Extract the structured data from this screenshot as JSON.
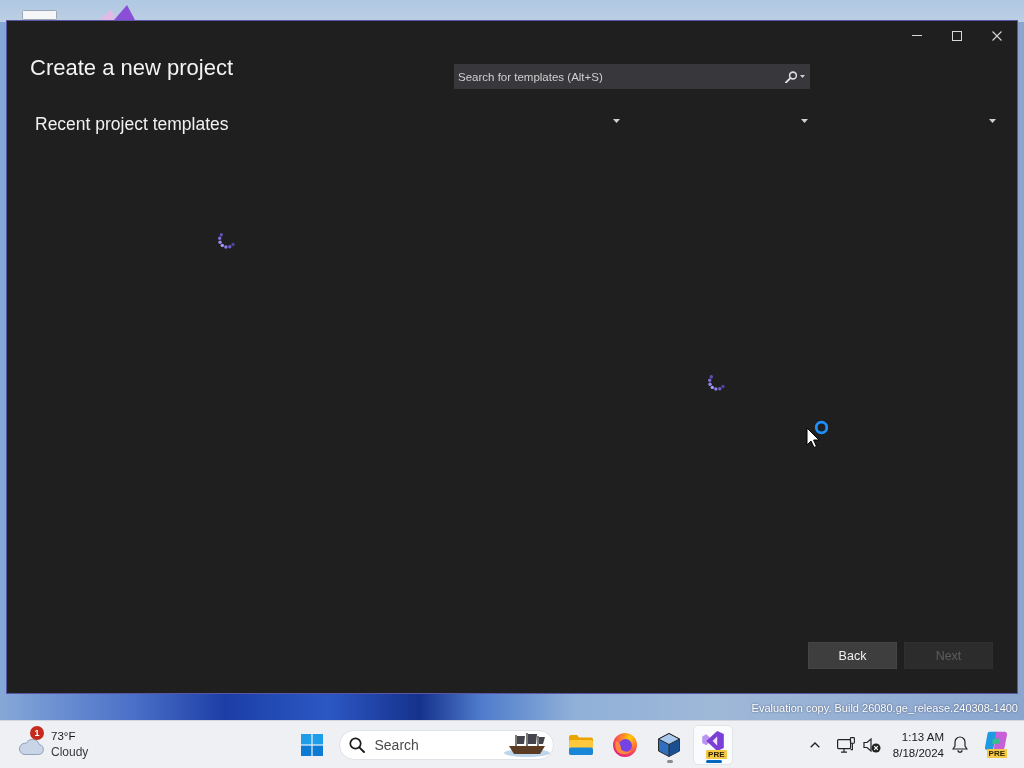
{
  "desktop": {
    "notice": "Evaluation copy. Build 26080.ge_release.240308-1400"
  },
  "window": {
    "controls": [
      {
        "kind": "minimize"
      },
      {
        "kind": "maximize"
      },
      {
        "kind": "close"
      }
    ],
    "heading": "Create a new project",
    "search": {
      "placeholder": "Search for templates (Alt+S)"
    },
    "recent_templates": {
      "heading": "Recent project templates",
      "loading": true
    },
    "filters": [
      {
        "expanded": false
      },
      {
        "expanded": false
      },
      {
        "expanded": false
      }
    ],
    "templates": {
      "loading": true
    },
    "buttons": [
      {
        "label": "Back",
        "disabled": false
      },
      {
        "label": "Next",
        "disabled": true
      }
    ]
  },
  "cursor": {
    "kind": "busy"
  },
  "taskbar": {
    "weather": {
      "badge": "1",
      "temperature": "73°F",
      "condition": "Cloudy"
    },
    "search": {
      "placeholder": "Search"
    },
    "apps": [
      {
        "kind": "folder",
        "running": false,
        "selected": false
      },
      {
        "kind": "browser",
        "running": false,
        "selected": false
      },
      {
        "kind": "cube",
        "running": true,
        "selected": false
      },
      {
        "kind": "studio",
        "running": true,
        "selected": true,
        "badge": "PRE"
      }
    ],
    "tray": [
      {
        "kind": "chevron"
      },
      {
        "kind": "monitor"
      },
      {
        "kind": "speaker-muted"
      },
      {
        "kind": "clock",
        "time": "1:13 AM",
        "date": "8/18/2024"
      },
      {
        "kind": "bell"
      },
      {
        "kind": "assistant",
        "badge": "PRE"
      }
    ]
  }
}
